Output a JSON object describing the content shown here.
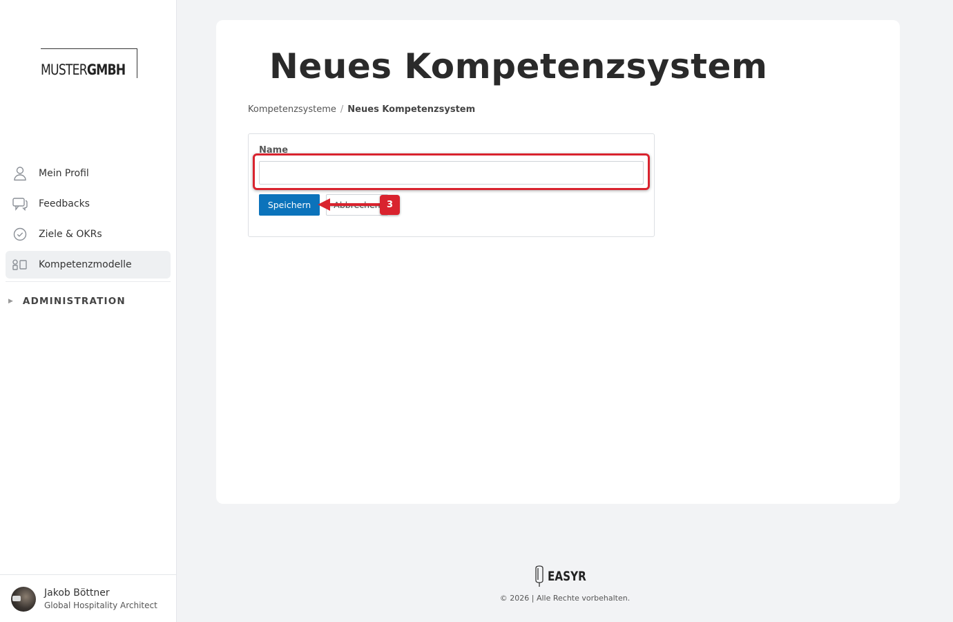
{
  "brand": {
    "logo_light": "MUSTER",
    "logo_bold": "GMBH"
  },
  "sidebar": {
    "items": [
      {
        "label": "Mein Profil",
        "icon": "user-icon"
      },
      {
        "label": "Feedbacks",
        "icon": "chat-icon"
      },
      {
        "label": "Ziele & OKRs",
        "icon": "check-circle-icon"
      },
      {
        "label": "Kompetenzmodelle",
        "icon": "shapes-icon",
        "active": true
      }
    ],
    "admin_label": "ADMINISTRATION",
    "admin_arrow": "▶"
  },
  "user": {
    "name": "Jakob Böttner",
    "role": "Global Hospitality Architect"
  },
  "main": {
    "title": "Neues Kompetenzsystem",
    "breadcrumb": {
      "parent": "Kompetenzsysteme",
      "separator": "/",
      "current": "Neues Kompetenzsystem"
    },
    "form": {
      "name_label": "Name",
      "name_value": "",
      "save_label": "Speichern",
      "cancel_label": "Abbrechen"
    }
  },
  "annotation": {
    "step": "3",
    "color": "#d9232e"
  },
  "footer": {
    "logo_text": "EASYR",
    "copyright": "© 2026 | Alle Rechte vorbehalten."
  },
  "colors": {
    "primary": "#0b73bb",
    "background": "#f2f3f5",
    "active_nav": "#eef0f2"
  }
}
